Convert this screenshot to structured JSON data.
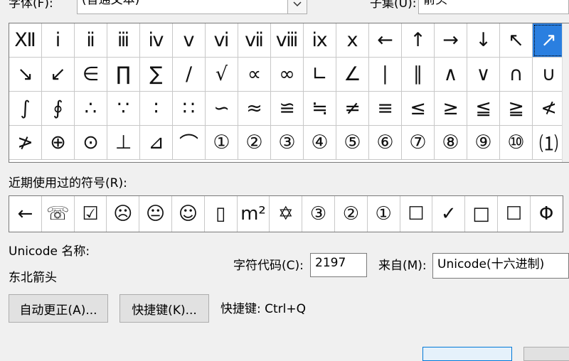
{
  "font": {
    "label": "字体(F):",
    "value": "(普通文本)"
  },
  "subset": {
    "label": "子集(U):",
    "value": "箭头"
  },
  "symbols": [
    "Ⅻ",
    "ⅰ",
    "ⅱ",
    "ⅲ",
    "ⅳ",
    "ⅴ",
    "ⅵ",
    "ⅶ",
    "ⅷ",
    "ⅸ",
    "ⅹ",
    "←",
    "↑",
    "→",
    "↓",
    "↖",
    "↗",
    "↘",
    "↙",
    "∈",
    "∏",
    "∑",
    "∕",
    "√",
    "∝",
    "∞",
    "∟",
    "∠",
    "∣",
    "∥",
    "∧",
    "∨",
    "∩",
    "∪",
    "∫",
    "∮",
    "∴",
    "∵",
    "∶",
    "∷",
    "∽",
    "≈",
    "≌",
    "≒",
    "≠",
    "≡",
    "≤",
    "≥",
    "≦",
    "≧",
    "≮",
    "≯",
    "⊕",
    "⊙",
    "⊥",
    "⊿",
    "⌒",
    "①",
    "②",
    "③",
    "④",
    "⑤",
    "⑥",
    "⑦",
    "⑧",
    "⑨",
    "⑩",
    "⑴"
  ],
  "selected_index": 16,
  "recent": {
    "label": "近期使用过的符号(R):",
    "items": [
      "←",
      "☏",
      "☑",
      "☹",
      "😐",
      "☺",
      "▯",
      "m²",
      "✡",
      "③",
      "②",
      "①",
      "☐",
      "✓",
      "□",
      "☐",
      "Φ"
    ]
  },
  "unicode_name": {
    "label": "Unicode 名称:",
    "value": "东北箭头"
  },
  "char_code": {
    "label": "字符代码(C):",
    "value": "2197"
  },
  "from": {
    "label": "来自(M):",
    "value": "Unicode(十六进制)"
  },
  "buttons": {
    "autocorrect": "自动更正(A)...",
    "shortcut_key": "快捷键(K)..."
  },
  "shortcut_text": "快捷键: Ctrl+Q"
}
